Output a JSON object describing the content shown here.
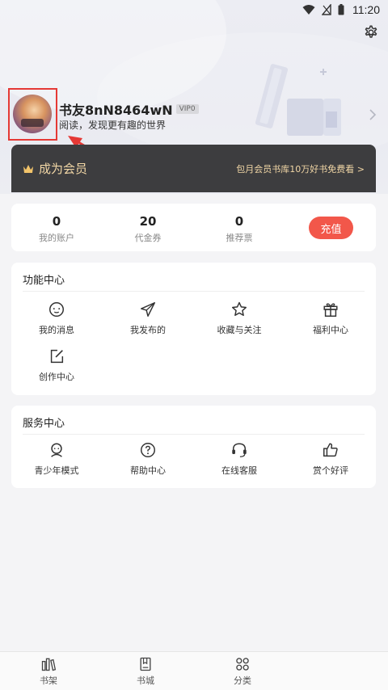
{
  "status_bar": {
    "time": "11:20"
  },
  "profile": {
    "username": "书友8nN8464wN",
    "vip_level": "VIP0",
    "signature": "阅读，发现更有趣的世界"
  },
  "vip_banner": {
    "title": "成为会员",
    "promo": "包月会员书库10万好书免费看 >"
  },
  "account": {
    "stats": [
      {
        "value": "0",
        "label": "我的账户"
      },
      {
        "value": "20",
        "label": "代金券"
      },
      {
        "value": "0",
        "label": "推荐票"
      }
    ],
    "recharge_label": "充值"
  },
  "function_center": {
    "title": "功能中心",
    "items": [
      {
        "label": "我的消息",
        "icon": "message-icon"
      },
      {
        "label": "我发布的",
        "icon": "send-icon"
      },
      {
        "label": "收藏与关注",
        "icon": "star-icon"
      },
      {
        "label": "福利中心",
        "icon": "gift-icon"
      },
      {
        "label": "创作中心",
        "icon": "edit-icon"
      }
    ]
  },
  "service_center": {
    "title": "服务中心",
    "items": [
      {
        "label": "青少年模式",
        "icon": "teen-mode-icon"
      },
      {
        "label": "帮助中心",
        "icon": "help-icon"
      },
      {
        "label": "在线客服",
        "icon": "headset-icon"
      },
      {
        "label": "赏个好评",
        "icon": "thumbs-up-icon"
      }
    ]
  },
  "bottom_nav": [
    {
      "label": "书架",
      "icon": "bookshelf-icon"
    },
    {
      "label": "书城",
      "icon": "bookstore-icon"
    },
    {
      "label": "分类",
      "icon": "category-icon"
    }
  ],
  "colors": {
    "accent_red": "#f2574a",
    "vip_gold": "#f2d7a6",
    "vip_banner_bg": "#3d3d3f",
    "annotation_red": "#e53935"
  }
}
